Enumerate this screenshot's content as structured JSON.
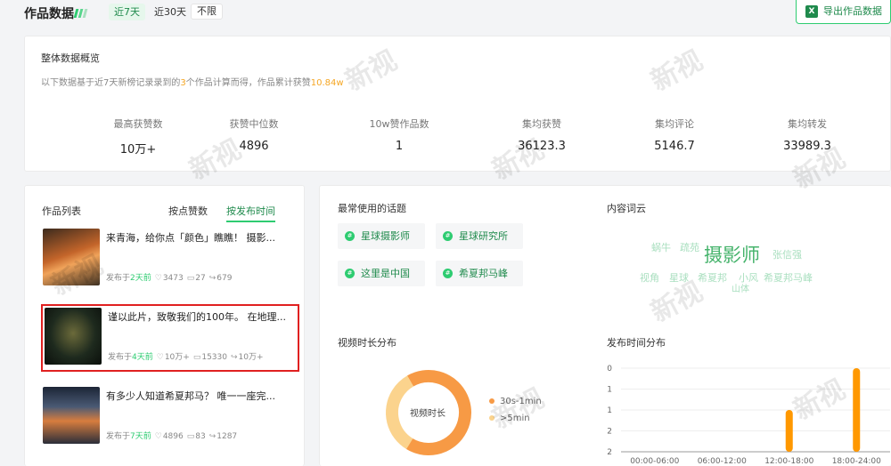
{
  "header": {
    "title": "作品数据",
    "ranges": [
      "近7天",
      "近30天",
      "不限"
    ],
    "export_label": "导出作品数据",
    "export_icon": "X"
  },
  "overview": {
    "title": "整体数据概览",
    "sub_prefix": "以下数据基于近7天新榜记录录到的",
    "sub_count": "3",
    "sub_mid": "个作品计算而得，作品累计获赞",
    "sub_total": "10.84w",
    "stats": [
      {
        "label": "最高获赞数",
        "value": "10万+"
      },
      {
        "label": "获赞中位数",
        "value": "4896"
      },
      {
        "label": "10w赞作品数",
        "value": "1"
      },
      {
        "label": "集均获赞",
        "value": "36123.3"
      },
      {
        "label": "集均评论",
        "value": "5146.7"
      },
      {
        "label": "集均转发",
        "value": "33989.3"
      }
    ]
  },
  "works": {
    "title": "作品列表",
    "sort_like": "按点赞数",
    "sort_time": "按发布时间",
    "items": [
      {
        "title": "来青海，给你点「颜色」瞧瞧！ 摄影...",
        "prefix": "发布于",
        "when": "2天前",
        "likes": "3473",
        "comments": "27",
        "shares": "679"
      },
      {
        "title": "谨以此片，致敬我们的100年。 在地理...",
        "prefix": "发布于",
        "when": "4天前",
        "likes": "10万+",
        "comments": "15330",
        "shares": "10万+"
      },
      {
        "title": "有多少人知道希夏邦马？ 唯一一座完...",
        "prefix": "发布于",
        "when": "7天前",
        "likes": "4896",
        "comments": "83",
        "shares": "1287"
      }
    ]
  },
  "topics": {
    "title": "最常使用的话题",
    "tags": [
      "星球摄影师",
      "星球研究所",
      "这里是中国",
      "希夏邦马峰"
    ]
  },
  "cloud": {
    "title": "内容词云",
    "main": "摄影师",
    "words": [
      "蜗牛",
      "疏苑",
      "张信强",
      "视角",
      "星球",
      "希夏邦",
      "小风",
      "希夏邦马峰",
      "山体"
    ]
  },
  "duration": {
    "title": "视频时长分布",
    "center_label": "视频时长",
    "legend": [
      {
        "label": "30s-1min",
        "color": "#f79a45",
        "share": 0.67
      },
      {
        "label": ">5min",
        "color": "#fbd38d",
        "share": 0.33
      }
    ]
  },
  "chart_data": {
    "type": "bar",
    "title": "发布时间分布",
    "categories": [
      "00:00-06:00",
      "06:00-12:00",
      "12:00-18:00",
      "18:00-24:00"
    ],
    "values": [
      0,
      0,
      1,
      2
    ],
    "y_ticks": [
      "0",
      "1",
      "1",
      "2",
      "2"
    ],
    "ylim": [
      0,
      2
    ],
    "color": "#ff9800"
  },
  "watermark": {
    "text": "新视"
  }
}
